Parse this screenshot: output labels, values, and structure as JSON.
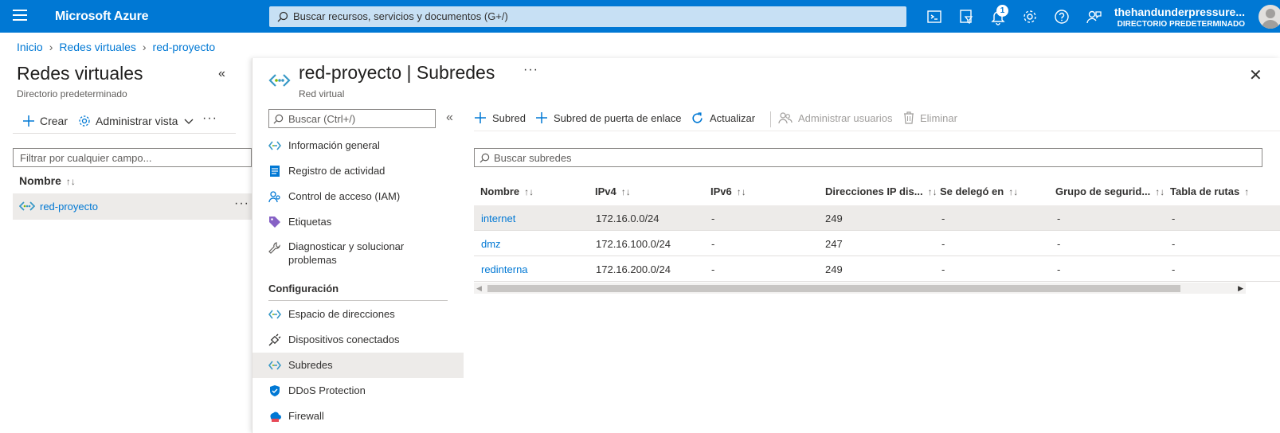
{
  "topbar": {
    "brand": "Microsoft Azure",
    "search_placeholder": "Buscar recursos, servicios y documentos (G+/)",
    "notification_count": "1",
    "user_name": "thehandunderpressure...",
    "user_directory": "DIRECTORIO PREDETERMINADO",
    "icons": [
      "cloud-shell-icon",
      "directory-filter-icon",
      "bell-icon",
      "gear-icon",
      "help-icon",
      "feedback-icon"
    ]
  },
  "breadcrumb": [
    "Inicio",
    "Redes virtuales",
    "red-proyecto"
  ],
  "left_panel": {
    "title": "Redes virtuales",
    "subtitle": "Directorio predeterminado",
    "toolbar": {
      "create": "Crear",
      "manage_view": "Administrar vista"
    },
    "filter_placeholder": "Filtrar por cualquier campo...",
    "column_header": "Nombre",
    "items": [
      {
        "name": "red-proyecto"
      }
    ]
  },
  "blade": {
    "name": "red-proyecto",
    "section": "Subredes",
    "subtitle": "Red virtual",
    "menu_search_placeholder": "Buscar (Ctrl+/)",
    "menu_items": [
      {
        "label": "Información general",
        "icon": "vnet-icon"
      },
      {
        "label": "Registro de actividad",
        "icon": "activity-log-icon"
      },
      {
        "label": "Control de acceso (IAM)",
        "icon": "iam-icon"
      },
      {
        "label": "Etiquetas",
        "icon": "tag-icon"
      },
      {
        "label": "Diagnosticar y solucionar problemas",
        "icon": "wrench-icon"
      }
    ],
    "config_section": "Configuración",
    "config_items": [
      {
        "label": "Espacio de direcciones",
        "icon": "vnet-icon"
      },
      {
        "label": "Dispositivos conectados",
        "icon": "plug-icon"
      },
      {
        "label": "Subredes",
        "icon": "vnet-icon",
        "active": true
      },
      {
        "label": "DDoS Protection",
        "icon": "shield-icon"
      },
      {
        "label": "Firewall",
        "icon": "firewall-icon"
      }
    ],
    "commands": {
      "subnet": "Subred",
      "gateway_subnet": "Subred de puerta de enlace",
      "refresh": "Actualizar",
      "manage_users": "Administrar usuarios",
      "delete": "Eliminar"
    },
    "subnet_search_placeholder": "Buscar subredes",
    "table": {
      "columns": [
        "Nombre",
        "IPv4",
        "IPv6",
        "Direcciones IP dis...",
        "Se delegó en",
        "Grupo de segurid...",
        "Tabla de rutas"
      ],
      "rows": [
        [
          "internet",
          "172.16.0.0/24",
          "-",
          "249",
          "-",
          "-",
          "-"
        ],
        [
          "dmz",
          "172.16.100.0/24",
          "-",
          "247",
          "-",
          "-",
          "-"
        ],
        [
          "redinterna",
          "172.16.200.0/24",
          "-",
          "249",
          "-",
          "-",
          "-"
        ]
      ]
    }
  },
  "colors": {
    "accent": "#0078d4",
    "topbar": "#0078d4",
    "search": "#c7e0f4",
    "selected_row": "#edebe9"
  }
}
